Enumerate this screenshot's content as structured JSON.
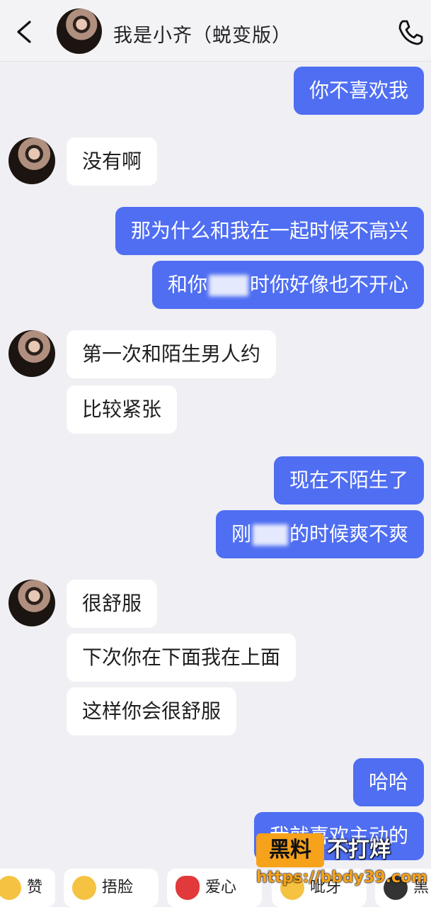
{
  "header": {
    "title": "我是小齐（蜕变版）",
    "back_icon": "chevron-left",
    "call_icon": "phone"
  },
  "messages": [
    {
      "side": "out",
      "text": "你不喜欢我"
    },
    {
      "side": "in",
      "text": "没有啊"
    },
    {
      "side": "out",
      "text": "那为什么和我在一起时候不高兴"
    },
    {
      "side": "out",
      "text_before": "和你",
      "text_after": "时你好像也不开心"
    },
    {
      "side": "in",
      "text": "第一次和陌生男人约"
    },
    {
      "side": "in",
      "text": "比较紧张"
    },
    {
      "side": "out",
      "text": "现在不陌生了"
    },
    {
      "side": "out",
      "text_before": "刚",
      "text_after": "的时候爽不爽"
    },
    {
      "side": "in",
      "text": "很舒服"
    },
    {
      "side": "in",
      "text": "下次你在下面我在上面"
    },
    {
      "side": "in",
      "text": "这样你会很舒服"
    },
    {
      "side": "out",
      "text": "哈哈"
    },
    {
      "side": "out",
      "text": "我就喜欢主动的"
    }
  ],
  "reactions": [
    {
      "label": "赞",
      "icon": "thumbs-up"
    },
    {
      "label": "捂脸",
      "icon": "facepalm"
    },
    {
      "label": "爱心",
      "icon": "heart"
    },
    {
      "label": "呲牙",
      "icon": "grin"
    },
    {
      "label": "黑",
      "icon": "dark-face"
    }
  ],
  "watermark": {
    "brand": "黑料",
    "slogan": "不打烊",
    "url": "https://bbdy39.com"
  },
  "colors": {
    "outgoing_bubble": "#4f6ef2",
    "incoming_bubble": "#ffffff",
    "background": "#efeff4",
    "watermark_accent": "#f7a21b"
  }
}
